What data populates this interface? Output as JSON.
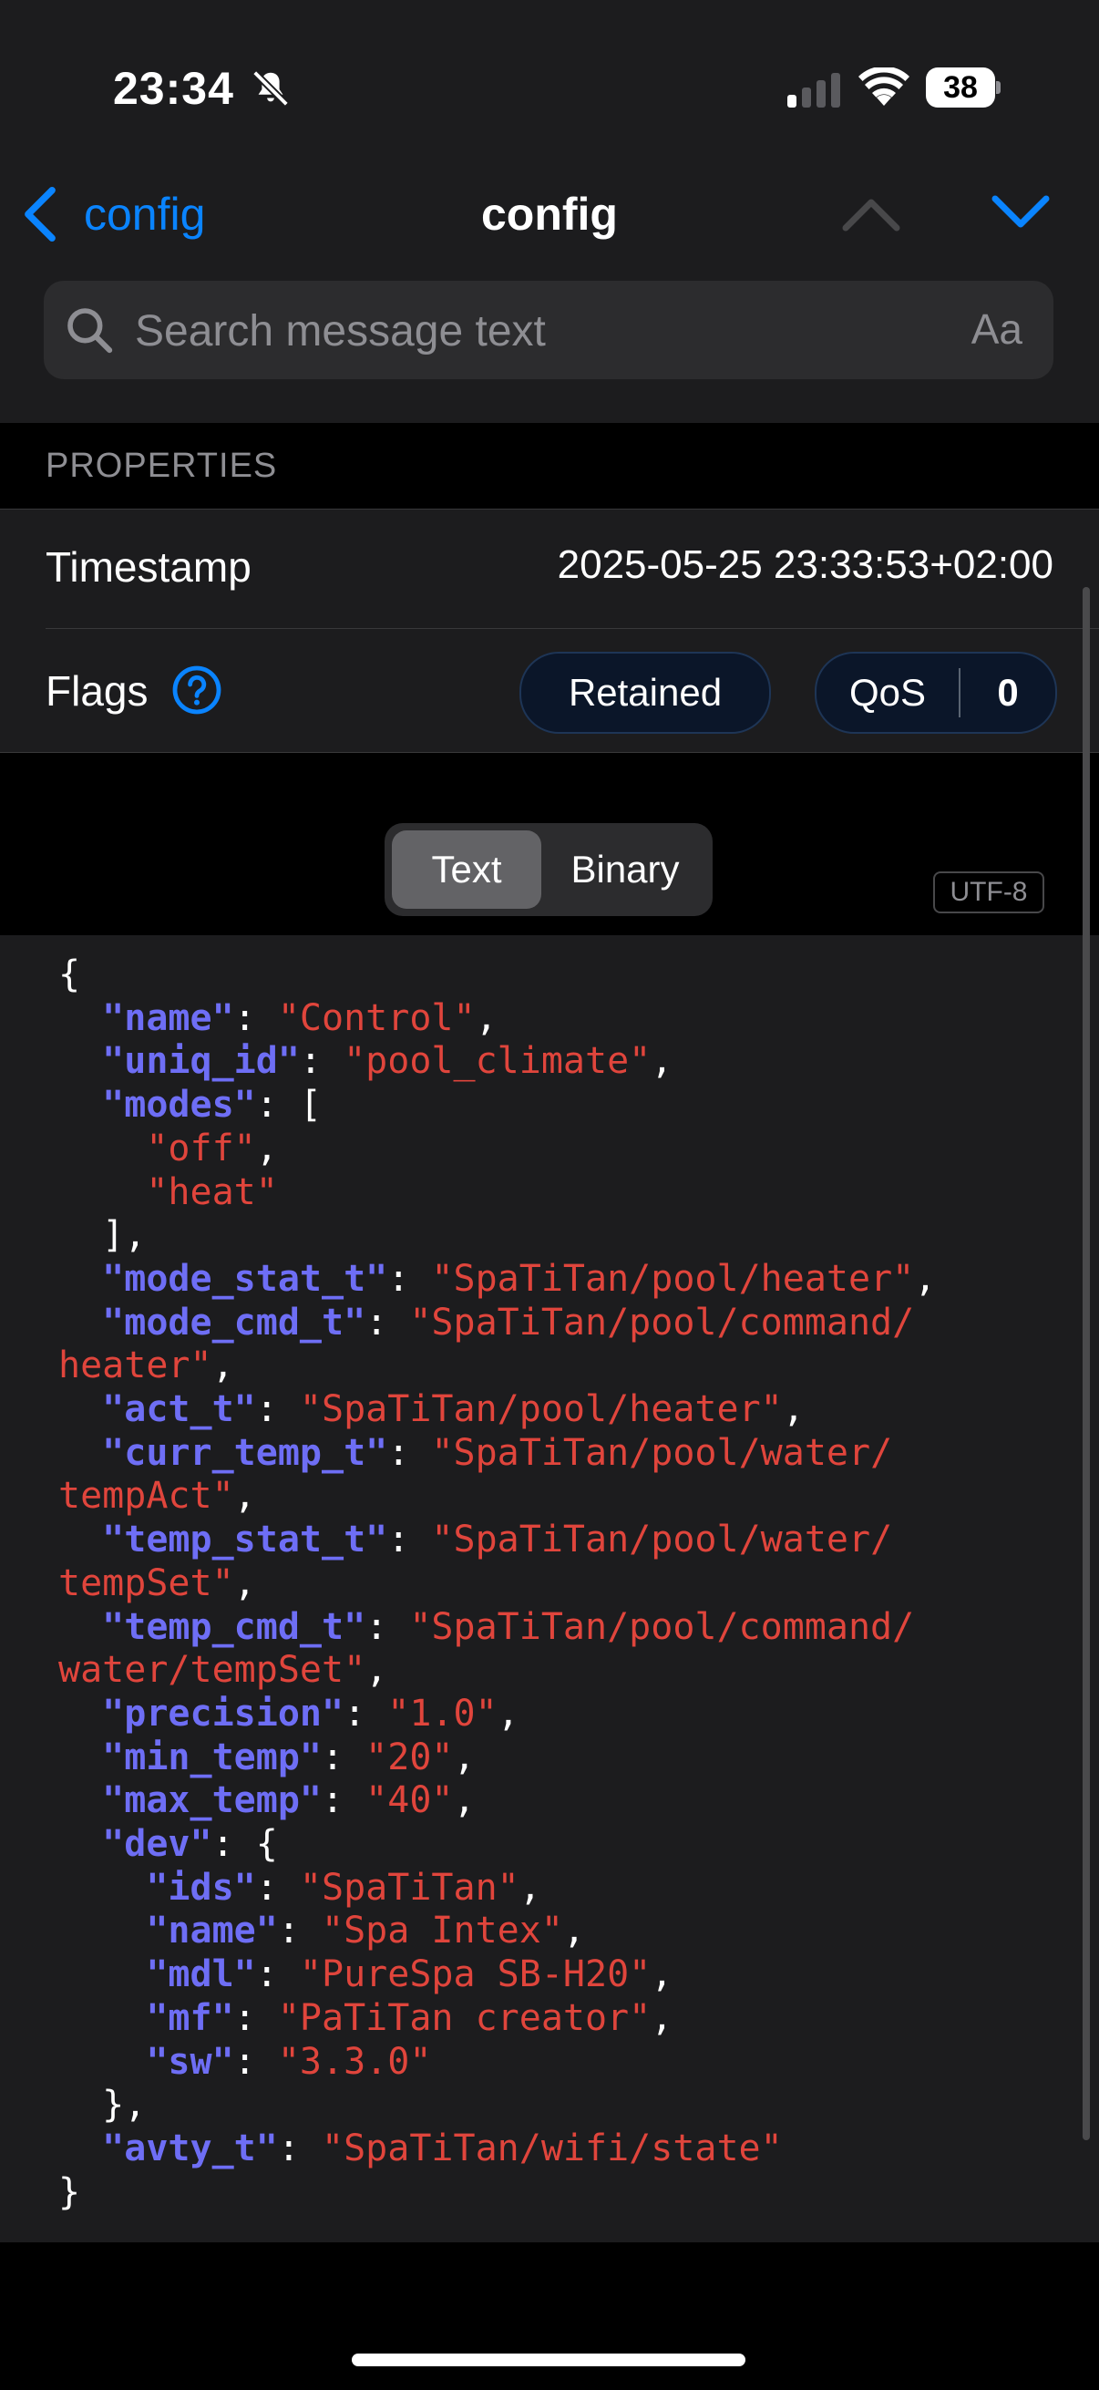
{
  "status_bar": {
    "time": "23:34",
    "battery_level": "38",
    "icons": [
      "bell-slash-icon",
      "cellular-signal-icon",
      "wifi-icon",
      "battery-icon"
    ]
  },
  "nav": {
    "back_label": "config",
    "title": "config",
    "icons": [
      "chevron-left-icon",
      "chevron-up-icon",
      "chevron-down-icon"
    ]
  },
  "search": {
    "placeholder": "Search message text",
    "case_toggle": "Aa"
  },
  "properties": {
    "section_title": "PROPERTIES",
    "timestamp_label": "Timestamp",
    "timestamp_value": "2025-05-25 23:33:53+02:00",
    "flags_label": "Flags",
    "retained_label": "Retained",
    "qos_label": "QoS",
    "qos_value": "0"
  },
  "view_mode": {
    "options": [
      "Text",
      "Binary"
    ],
    "selected": "Text",
    "encoding": "UTF-8"
  },
  "payload": {
    "line_01": "{",
    "name_key": "\"name\"",
    "name_val": "\"Control\"",
    "uniq_id_key": "\"uniq_id\"",
    "uniq_id_val": "\"pool_climate\"",
    "modes_key": "\"modes\"",
    "modes_val_1": "\"off\"",
    "modes_val_2": "\"heat\"",
    "mode_stat_t_key": "\"mode_stat_t\"",
    "mode_stat_t_val": "\"SpaTiTan/pool/heater\"",
    "mode_cmd_t_key": "\"mode_cmd_t\"",
    "mode_cmd_t_val_a": "\"SpaTiTan/pool/command/",
    "mode_cmd_t_val_b": "heater\"",
    "act_t_key": "\"act_t\"",
    "act_t_val": "\"SpaTiTan/pool/heater\"",
    "curr_temp_t_key": "\"curr_temp_t\"",
    "curr_temp_t_val_a": "\"SpaTiTan/pool/water/",
    "curr_temp_t_val_b": "tempAct\"",
    "temp_stat_t_key": "\"temp_stat_t\"",
    "temp_stat_t_val_a": "\"SpaTiTan/pool/water/",
    "temp_stat_t_val_b": "tempSet\"",
    "temp_cmd_t_key": "\"temp_cmd_t\"",
    "temp_cmd_t_val_a": "\"SpaTiTan/pool/command/",
    "temp_cmd_t_val_b": "water/tempSet\"",
    "precision_key": "\"precision\"",
    "precision_val": "\"1.0\"",
    "min_temp_key": "\"min_temp\"",
    "min_temp_val": "\"20\"",
    "max_temp_key": "\"max_temp\"",
    "max_temp_val": "\"40\"",
    "dev_key": "\"dev\"",
    "ids_key": "\"ids\"",
    "ids_val": "\"SpaTiTan\"",
    "dev_name_key": "\"name\"",
    "dev_name_val": "\"Spa Intex\"",
    "mdl_key": "\"mdl\"",
    "mdl_val": "\"PureSpa SB-H20\"",
    "mf_key": "\"mf\"",
    "mf_val": "\"PaTiTan creator\"",
    "sw_key": "\"sw\"",
    "sw_val": "\"3.3.0\"",
    "avty_t_key": "\"avty_t\"",
    "avty_t_val": "\"SpaTiTan/wifi/state\"",
    "line_last": "}"
  },
  "colors": {
    "accent": "#0a84ff",
    "json_key": "#6e6ef5",
    "json_string": "#e0453c",
    "panel": "#1c1c1e"
  }
}
